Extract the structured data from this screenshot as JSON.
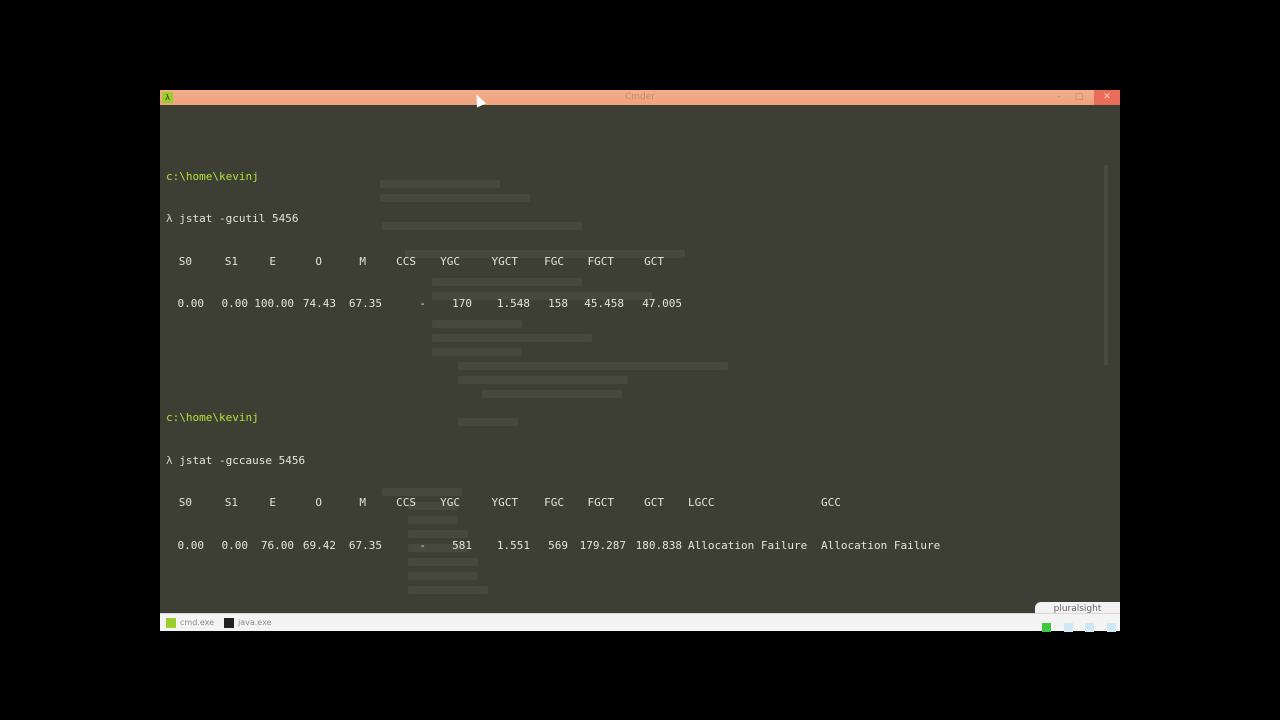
{
  "window": {
    "title": "Cmder",
    "icon": "lambda-icon",
    "minimize_glyph": "–",
    "maximize_glyph": "□",
    "close_glyph": "✕"
  },
  "console": {
    "prompt_path": "c:\\home\\kevinj",
    "prompt_symbol": "λ",
    "blocks": [
      {
        "command": "jstat -gcutil 5456",
        "headers": [
          "S0",
          "S1",
          "E",
          "O",
          "M",
          "CCS",
          "YGC",
          "YGCT",
          "FGC",
          "FGCT",
          "GCT"
        ],
        "values": [
          "0.00",
          "0.00",
          "100.00",
          "74.43",
          "67.35",
          "-",
          "170",
          "1.548",
          "158",
          "45.458",
          "47.005"
        ]
      },
      {
        "command": "jstat -gccause 5456",
        "headers": [
          "S0",
          "S1",
          "E",
          "O",
          "M",
          "CCS",
          "YGC",
          "YGCT",
          "FGC",
          "FGCT",
          "GCT",
          "LGCC",
          "GCC"
        ],
        "values": [
          "0.00",
          "0.00",
          "76.00",
          "69.42",
          "67.35",
          "-",
          "581",
          "1.551",
          "569",
          "179.287",
          "180.838",
          "Allocation Failure",
          "Allocation Failure"
        ]
      }
    ]
  },
  "taskbar": {
    "items": [
      {
        "label": "cmd.exe",
        "icon": "cmder-icon"
      },
      {
        "label": "java.exe",
        "icon": "console-icon"
      }
    ]
  },
  "watermark": "pluralsight",
  "colors": {
    "titlebar": "#eea27c",
    "console_bg": "#3d3f35",
    "prompt_path": "#b5e03a",
    "close_button": "#e96d59"
  }
}
